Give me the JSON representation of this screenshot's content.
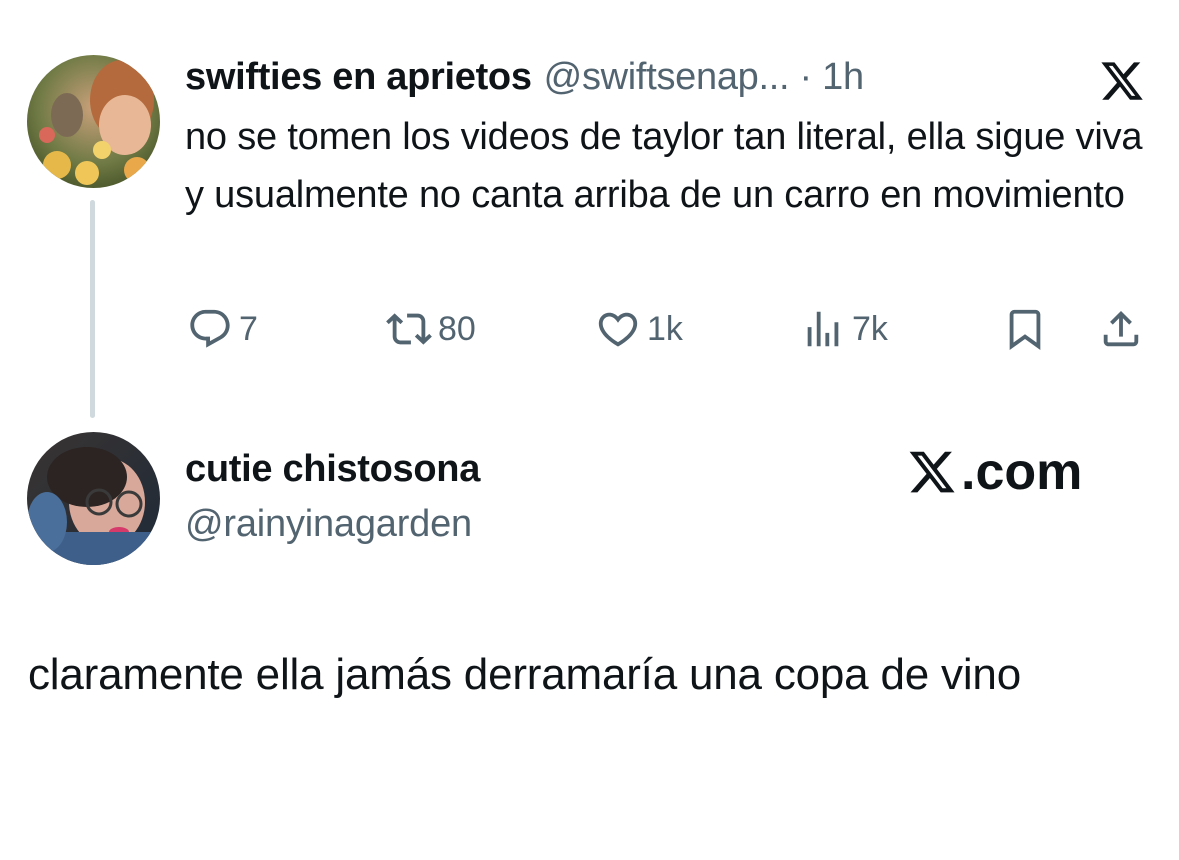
{
  "tweet": {
    "display_name": "swifties en aprietos",
    "handle_time": "@swiftsenap... · 1h",
    "text": "no se tomen los videos de taylor tan literal, ella sigue viva y usualmente no canta arriba de un carro en movimiento",
    "platform_icon": "x-logo-icon",
    "actions": {
      "replies": "7",
      "reposts": "80",
      "likes": "1k",
      "views": "7k"
    },
    "action_icons": [
      "reply-icon",
      "repost-icon",
      "like-icon",
      "views-icon",
      "bookmark-icon",
      "share-icon"
    ]
  },
  "reply": {
    "display_name": "cutie chistosona",
    "handle": "@rainyinagarden",
    "text": "claramente ella jamás derramaría una copa de vino",
    "brand_suffix": ".com"
  },
  "colors": {
    "text_primary": "#0f1419",
    "text_secondary": "#536471",
    "thread_line": "#cfd9de",
    "background": "#ffffff"
  }
}
